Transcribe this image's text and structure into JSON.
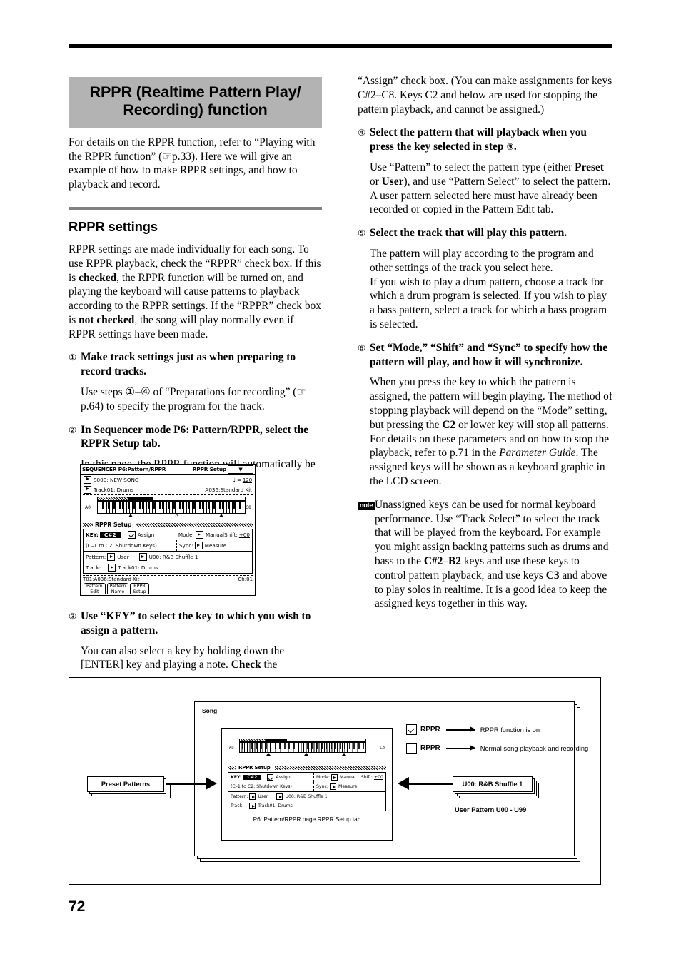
{
  "page": {
    "number": "72"
  },
  "left_column": {
    "chapter_title_line1": "RPPR (Realtime Pattern Play/",
    "chapter_title_line2": "Recording) function",
    "intro": "For details on the RPPR function, refer to “Playing with the RPPR function” (☞p.33). Here we will give an example of how to make RPPR settings, and how to playback and record.",
    "section_heading": "RPPR settings",
    "section_intro_1": "RPPR settings are made individually for each song. To use RPPR playback, check the “RPPR” check box. If this is ",
    "section_intro_bold_1": "checked",
    "section_intro_2": ", the RPPR function will be turned on, and playing the keyboard will cause patterns to playback according to the RPPR settings. If the “RPPR” check box is ",
    "section_intro_bold_2": "not checked",
    "section_intro_3": ", the song will play normally even if RPPR settings have been made.",
    "steps": [
      {
        "num": "①",
        "title": "Make track settings just as when preparing to record tracks.",
        "body": "Use steps ①–④ of “Preparations for recording” (☞p.64) to specify the program for the track."
      },
      {
        "num": "②",
        "title": "In Sequencer mode P6: Pattern/RPPR, select the RPPR Setup tab.",
        "body": "In this page, the RPPR function will automatically be on."
      },
      {
        "num": "③",
        "title": "Use “KEY” to select the key to which you wish to assign a pattern.",
        "body_1": "You can also select a key by holding down the [ENTER] key and playing a note. ",
        "body_bold": "Check",
        "body_2": " the"
      }
    ]
  },
  "right_column": {
    "continued_paragraph": "“Assign” check box. (You can make assignments for keys C#2–C8. Keys C2 and below are used for stopping the pattern playback, and cannot be assigned.)",
    "steps": [
      {
        "num": "④",
        "title_1": "Select the pattern that will playback when you press the key selected in step ",
        "title_circ": "③",
        "title_2": ".",
        "body_1": "Use “Pattern” to select the pattern type (either ",
        "body_b1": "Preset",
        "body_2": " or ",
        "body_b2": "User",
        "body_3": "), and use “Pattern Select” to select the pattern. A user pattern selected here must have already been recorded or copied in the Pattern Edit tab."
      },
      {
        "num": "⑤",
        "title": "Select the track that will play this pattern.",
        "body": "The pattern will play according to the program and other settings of the track you select here.\nIf you wish to play a drum pattern, choose a track for which a drum program is selected. If you wish to play a bass pattern, select a track for which a bass program is selected."
      },
      {
        "num": "⑥",
        "title": "Set “Mode,” “Shift” and “Sync” to specify how the pattern will play, and how it will synchronize.",
        "body_1": "When you press the key to which the pattern is assigned, the pattern will begin playing. The method of stopping playback will depend on the “Mode” setting, but pressing the ",
        "body_b1": "C2",
        "body_2": " or lower key will stop all patterns.\nFor details on these parameters and on how to stop the playback, refer to p.71 in the ",
        "body_i1": "Parameter Guide",
        "body_3": ". The assigned keys will be shown as a keyboard graphic in the LCD screen."
      }
    ],
    "note": {
      "icon_label": "note",
      "text_1": "Unassigned keys can be used for normal keyboard performance. Use “Track Select” to select the track that will be played from the keyboard. For example you might assign backing patterns such as drums and bass to the ",
      "text_b1": "C#2–B2",
      "text_2": " keys and use these keys to control pattern playback, and use keys ",
      "text_b2": "C3",
      "text_3": " and above to play solos in realtime. It is a good idea to keep the assigned keys together in this way."
    }
  },
  "lcd_screen": {
    "title_bar": {
      "mode_page": "SEQUENCER P6:Pattern/RPPR",
      "tab_name": "RPPR Setup",
      "menu_icon": "chevron-down-icon"
    },
    "song_row": {
      "value": "S000: NEW SONG",
      "tempo_label": "♩ =",
      "tempo_value": "120"
    },
    "track_row": {
      "value": "Track01: Drums",
      "program": "A036:Standard Kit"
    },
    "keyboard": {
      "low_label": "A0",
      "high_label": "C8"
    },
    "group_label": "RPPR Setup",
    "fields": {
      "key_label": "KEY:",
      "key_value": "C#2",
      "assign_label": "Assign",
      "assign_checked": true,
      "key_note": "(C–1 to C2: Shutdown Keys)",
      "mode_label": "Mode:",
      "mode_value": "Manual",
      "shift_label": "Shift:",
      "shift_value": "+00",
      "sync_label": "Sync:",
      "sync_value": "Measure",
      "pattern_label": "Pattern:",
      "pattern_bank": "User",
      "pattern_select": "U00: R&B Shuffle 1",
      "track_label": "Track:",
      "track_value": "Track01: Drums"
    },
    "status_bar": {
      "left": "T01:A036:Standard Kit",
      "right": "Ch:01"
    },
    "tabs": [
      {
        "line1": "Pattern",
        "line2": "Edit"
      },
      {
        "line1": "Pattern",
        "line2": "Name"
      },
      {
        "line1": "RPPR",
        "line2": "Setup"
      }
    ]
  },
  "figure": {
    "song_label": "Song",
    "lcd_caption": "P6: Pattern/RPPR page RPPR Setup tab",
    "preset_patterns_label": "Preset Patterns",
    "user_pattern_card": "U00: R&B Shuffle 1",
    "user_pattern_caption": "User Pattern U00 - U99",
    "legend": [
      {
        "checked": true,
        "label": "RPPR",
        "text": "RPPR function is on"
      },
      {
        "checked": false,
        "label": "RPPR",
        "text": "Normal song playback and recording"
      }
    ]
  }
}
